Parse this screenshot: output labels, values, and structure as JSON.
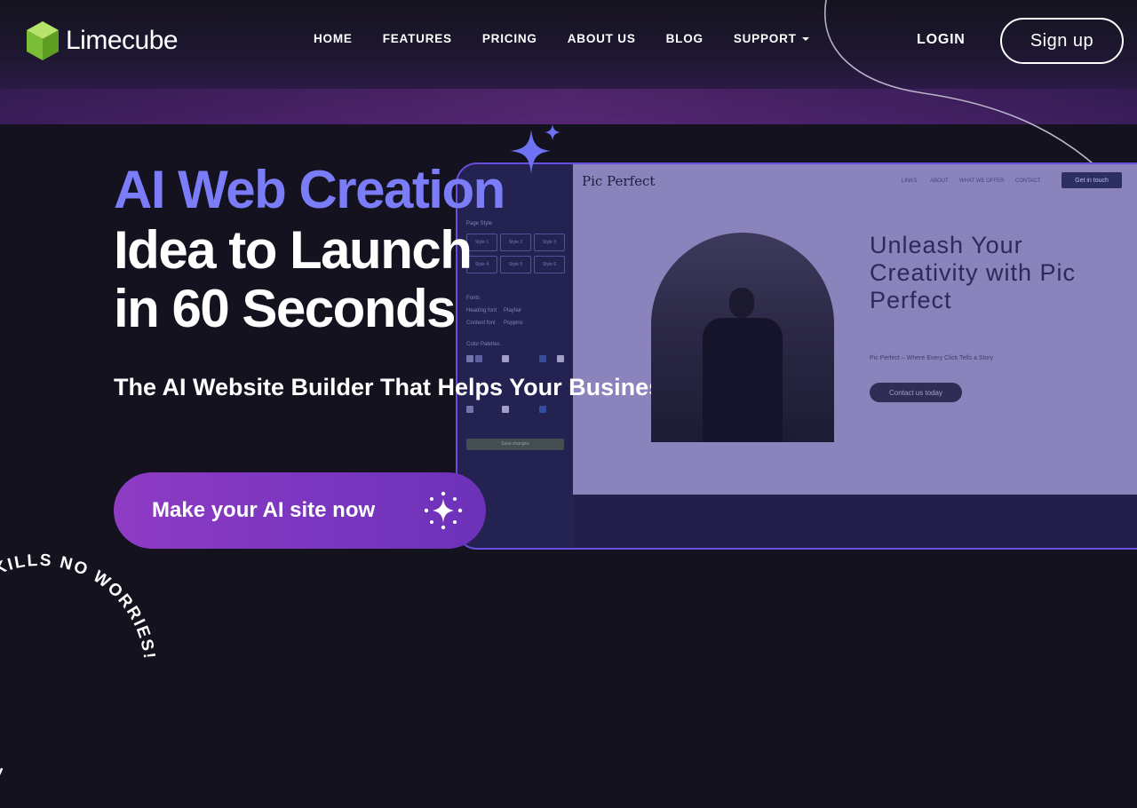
{
  "brand": {
    "name": "Limecube"
  },
  "nav": {
    "items": [
      {
        "label": "HOME"
      },
      {
        "label": "FEATURES"
      },
      {
        "label": "PRICING"
      },
      {
        "label": "ABOUT US"
      },
      {
        "label": "BLOG"
      },
      {
        "label": "SUPPORT"
      }
    ],
    "login": "LOGIN",
    "signup": "Sign up"
  },
  "hero": {
    "accent": "AI Web Creation",
    "line2": "Idea to Launch",
    "line3": "in 60 Seconds",
    "subheading": "The AI Website Builder That Helps Your Business Grow",
    "cta": "Make your AI site now"
  },
  "preview": {
    "brand": "Pic Perfect",
    "nav": [
      "LINKS",
      "ABOUT",
      "WHAT WE OFFER",
      "CONTACT"
    ],
    "cta": "Get in touch",
    "heading": "Unleash Your Creativity with Pic Perfect",
    "tagline": "Pic Perfect – Where Every Click Tells a Story",
    "contact": "Contact us today",
    "sidebar": {
      "page_style": "Page Style",
      "style_options": [
        "Style 1",
        "Style 2",
        "Style 3",
        "Style 4",
        "Style 5",
        "Style 6"
      ],
      "fonts": "Fonts",
      "heading_font": "Heading font",
      "content_font": "Content font",
      "heading_font_value": "Playfair",
      "content_font_value": "Poppins",
      "color_palettes": "Color Palettes",
      "save": "Save changes"
    }
  },
  "badge": {
    "text": "MADE IN LIMECUBE  NO SKILLS  NO WORRIES!  "
  },
  "colors": {
    "background": "#14121f",
    "accent": "#7b7cf7",
    "cta": "#8f3bc4",
    "logo": "#8dc63f"
  }
}
